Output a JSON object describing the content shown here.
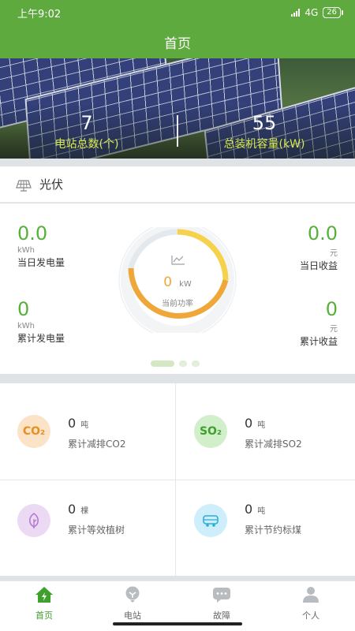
{
  "status_bar": {
    "time": "上午9:02",
    "network": "4G",
    "battery": "26"
  },
  "nav": {
    "title": "首页"
  },
  "banner": {
    "stations": {
      "value": "7",
      "label": "电站总数(个)"
    },
    "capacity": {
      "value": "55",
      "label": "总装机容量(kW)"
    }
  },
  "pv": {
    "title": "光伏",
    "today_energy": {
      "value": "0.0",
      "unit": "kWh",
      "label": "当日发电量"
    },
    "total_energy": {
      "value": "0",
      "unit": "kWh",
      "label": "累计发电量"
    },
    "today_income": {
      "value": "0.0",
      "unit": "元",
      "label": "当日收益"
    },
    "total_income": {
      "value": "0",
      "unit": "元",
      "label": "累计收益"
    },
    "power": {
      "value": "0",
      "unit": "kW",
      "label": "当前功率"
    },
    "page_indicator": {
      "active": 1,
      "count": 3
    }
  },
  "savings": [
    {
      "icon": "co2-icon",
      "icon_text": "CO₂",
      "value": "0",
      "unit": "吨",
      "label": "累计减排CO2"
    },
    {
      "icon": "so2-icon",
      "icon_text": "SO₂",
      "value": "0",
      "unit": "吨",
      "label": "累计减排SO2"
    },
    {
      "icon": "leaf-icon",
      "value": "0",
      "unit": "棵",
      "label": "累计等效植树"
    },
    {
      "icon": "coal-cart-icon",
      "value": "0",
      "unit": "吨",
      "label": "累计节约标煤"
    }
  ],
  "tabs": [
    {
      "label": "首页",
      "icon": "home-bolt-icon",
      "active": true
    },
    {
      "label": "电站",
      "icon": "station-icon",
      "active": false
    },
    {
      "label": "故障",
      "icon": "fault-chat-icon",
      "active": false
    },
    {
      "label": "个人",
      "icon": "person-icon",
      "active": false
    }
  ],
  "colors": {
    "brand": "#5eaa3f",
    "value_green": "#55b13a",
    "gauge_orange": "#f0a73a",
    "gauge_yellow": "#f5d24a"
  }
}
